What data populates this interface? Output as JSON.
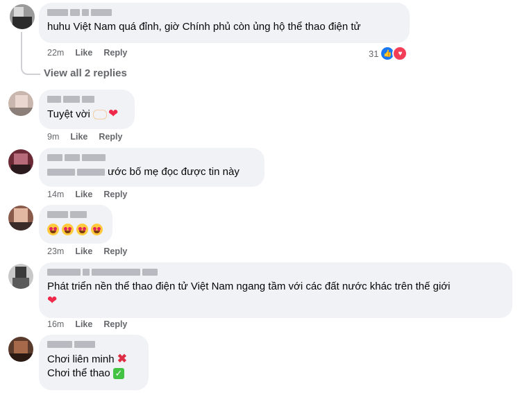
{
  "actions": {
    "like": "Like",
    "reply": "Reply"
  },
  "comments": [
    {
      "text": "huhu Việt Nam quá đỉnh, giờ Chính phủ còn ủng hộ thể thao điện tử",
      "time": "22m",
      "reaction_count": "31"
    },
    {
      "text": "Tuyệt vời",
      "time": "9m"
    },
    {
      "text": "ước bố mẹ đọc được tin này",
      "time": "14m"
    },
    {
      "text": "",
      "time": "23m"
    },
    {
      "text_line1": "Phát triển nền thể thao điện tử Việt Nam ngang tầm với các đất nước khác trên thế giới",
      "time": "16m"
    },
    {
      "text_line1": "Chơi liên minh",
      "text_line2": "Chơi thể thao"
    }
  ],
  "view_replies": "View all 2 replies",
  "icons": [
    "like-reaction-icon",
    "love-reaction-icon",
    "heart-emoji-icon",
    "heart-eyes-emoji-icon",
    "cross-mark-emoji-icon",
    "check-mark-emoji-icon"
  ],
  "colors": {
    "bubble": "#f0f2f5",
    "meta": "#65676b",
    "like_blue": "#1877f2",
    "love_red": "#f33e58"
  }
}
